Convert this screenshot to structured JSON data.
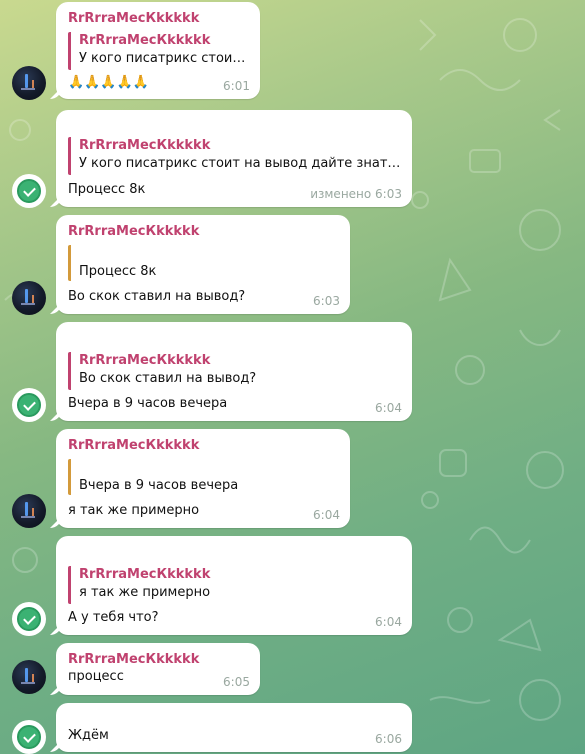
{
  "chat": {
    "messages": [
      {
        "sender": "RrRrraМесКkkkkk",
        "reply_sender": "RrRrraМесКkkkkk",
        "reply_text": "У кого писатрикс стоит на...",
        "text": "🙏🙏🙏🙏🙏",
        "time": "6:01"
      },
      {
        "reply_sender": "RrRrraМесКkkkkk",
        "reply_text": "У кого писатрикс стоит на вывод дайте знать че у ...",
        "text": "Процесс 8к",
        "time": "изменено 6:03"
      },
      {
        "sender": "RrRrraМесКkkkkk",
        "reply_text": "Процесс 8к",
        "text": "Во скок ставил на вывод?",
        "time": "6:03"
      },
      {
        "reply_sender": "RrRrraМесКkkkkk",
        "reply_text": "Во скок ставил на вывод?",
        "text": "Вчера в 9 часов вечера",
        "time": "6:04"
      },
      {
        "sender": "RrRrraМесКkkkkk",
        "reply_text": "Вчера в 9 часов вечера",
        "text": "я так же примерно",
        "time": "6:04"
      },
      {
        "reply_sender": "RrRrraМесКkkkkk",
        "reply_text": "я так же примерно",
        "text": "А у тебя что?",
        "time": "6:04"
      },
      {
        "sender": "RrRrraМесКkkkkk",
        "text": "процесс",
        "time": "6:05"
      },
      {
        "text": "Ждём",
        "time": "6:06"
      }
    ]
  },
  "colors": {
    "sender_name": "#c0426f",
    "quote_bar_self": "#d39a3b",
    "verified_badge": "#3bb273"
  },
  "icons": {
    "remote_avatar": "user-avatar-icon",
    "own_avatar": "verified-check-icon"
  }
}
